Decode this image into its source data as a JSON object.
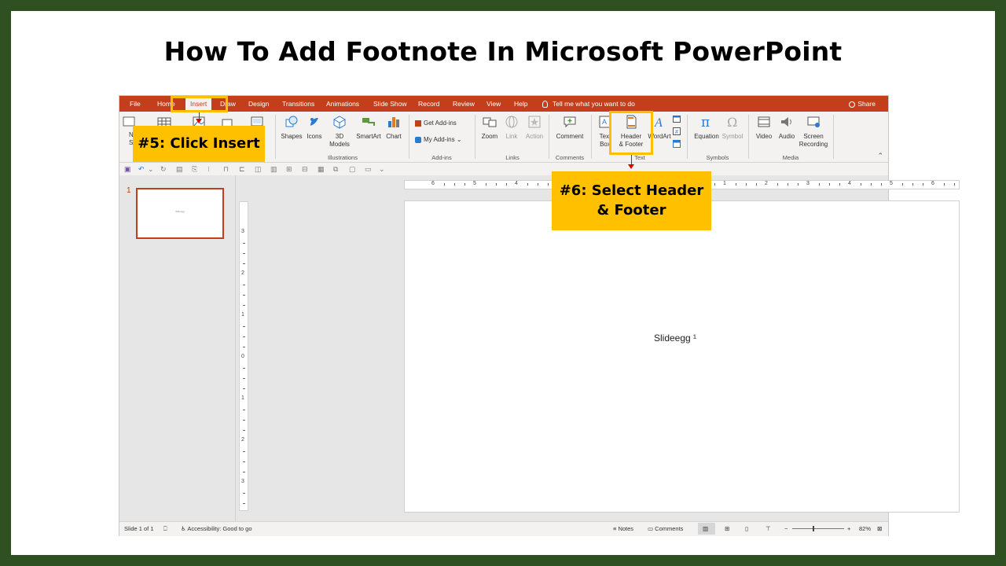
{
  "page": {
    "title": "How To Add Footnote In Microsoft PowerPoint"
  },
  "ribbon_tabs": [
    "File",
    "Home",
    "Insert",
    "Draw",
    "Design",
    "Transitions",
    "Animations",
    "Slide Show",
    "Record",
    "Review",
    "View",
    "Help"
  ],
  "tell_me": "Tell me what you want to do",
  "share": "Share",
  "ribbon": {
    "new_slide": "N\nSli",
    "shapes": "Shapes",
    "icons": "Icons",
    "models_3d": "3D\nModels",
    "smartart": "SmartArt",
    "chart": "Chart",
    "illustrations_group": "Illustrations",
    "get_addins": "Get Add-ins",
    "my_addins": "My Add-ins",
    "addins_group": "Add-ins",
    "zoom": "Zoom",
    "link": "Link",
    "action": "Action",
    "links_group": "Links",
    "comment": "Comment",
    "comments_group": "Comments",
    "text_box": "Text\nBox",
    "header_footer": "Header\n& Footer",
    "wordart": "WordArt",
    "text_group": "Text",
    "equation": "Equation",
    "symbol": "Symbol",
    "symbols_group": "Symbols",
    "video": "Video",
    "audio": "Audio",
    "screen_recording": "Screen\nRecording",
    "media_group": "Media",
    "slides_group_partial": "Sli"
  },
  "thumbnail": {
    "number": "1",
    "text": "Slideegg"
  },
  "slide_text": "Slideegg ¹",
  "ruler_h": [
    "6",
    "5",
    "4",
    "3",
    "2",
    "1",
    "0",
    "1",
    "2",
    "3",
    "4",
    "5",
    "6"
  ],
  "ruler_v": [
    "3",
    "2",
    "1",
    "0",
    "1",
    "2",
    "3"
  ],
  "status": {
    "slide_of": "Slide 1 of 1",
    "accessibility": "Accessibility: Good to go",
    "notes": "Notes",
    "comments": "Comments",
    "zoom": "82%"
  },
  "callouts": {
    "step5": "#5: Click Insert",
    "step6": "#6: Select Header & Footer"
  },
  "colors": {
    "frame": "#2f5122",
    "ribbon_accent": "#c43e1c",
    "callout": "#ffc000",
    "arrow": "#e00000"
  }
}
